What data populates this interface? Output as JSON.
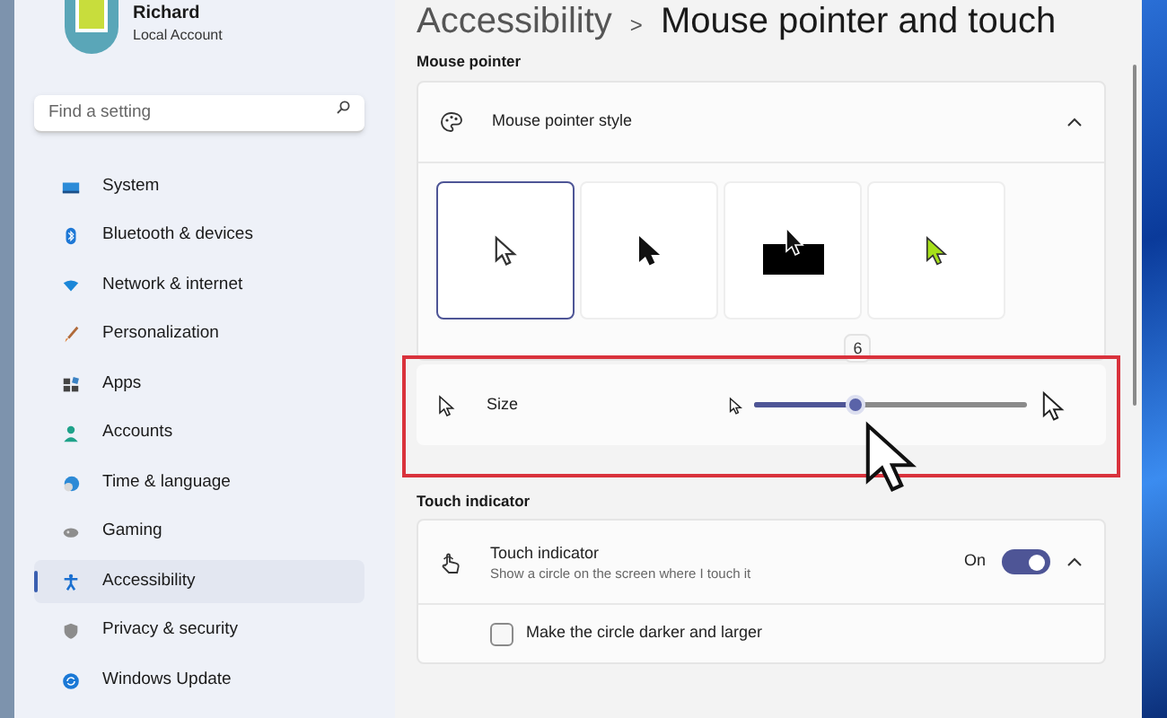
{
  "profile": {
    "name": "Richard",
    "account": "Local Account"
  },
  "search": {
    "placeholder": "Find a setting"
  },
  "nav": [
    {
      "label": "System",
      "selected": false
    },
    {
      "label": "Bluetooth & devices",
      "selected": false
    },
    {
      "label": "Network & internet",
      "selected": false
    },
    {
      "label": "Personalization",
      "selected": false
    },
    {
      "label": "Apps",
      "selected": false
    },
    {
      "label": "Accounts",
      "selected": false
    },
    {
      "label": "Time & language",
      "selected": false
    },
    {
      "label": "Gaming",
      "selected": false
    },
    {
      "label": "Accessibility",
      "selected": true
    },
    {
      "label": "Privacy & security",
      "selected": false
    },
    {
      "label": "Windows Update",
      "selected": false
    }
  ],
  "breadcrumb": {
    "parent": "Accessibility",
    "separator": ">",
    "current": "Mouse pointer and touch"
  },
  "mouse_pointer": {
    "heading": "Mouse pointer",
    "style_label": "Mouse pointer style",
    "expanded": true,
    "styles": [
      {
        "kind": "white",
        "selected": true
      },
      {
        "kind": "black",
        "selected": false
      },
      {
        "kind": "inverted",
        "selected": false
      },
      {
        "kind": "custom",
        "selected": false
      }
    ],
    "size": {
      "label": "Size",
      "level": 0.37,
      "value": "6",
      "highlighted": true
    }
  },
  "touch": {
    "heading": "Touch indicator",
    "title": "Touch indicator",
    "description": "Show a circle on the screen where I touch it",
    "state": "On",
    "on": true,
    "expanded": true,
    "option": {
      "label": "Make the circle darker and larger",
      "checked": false
    }
  }
}
